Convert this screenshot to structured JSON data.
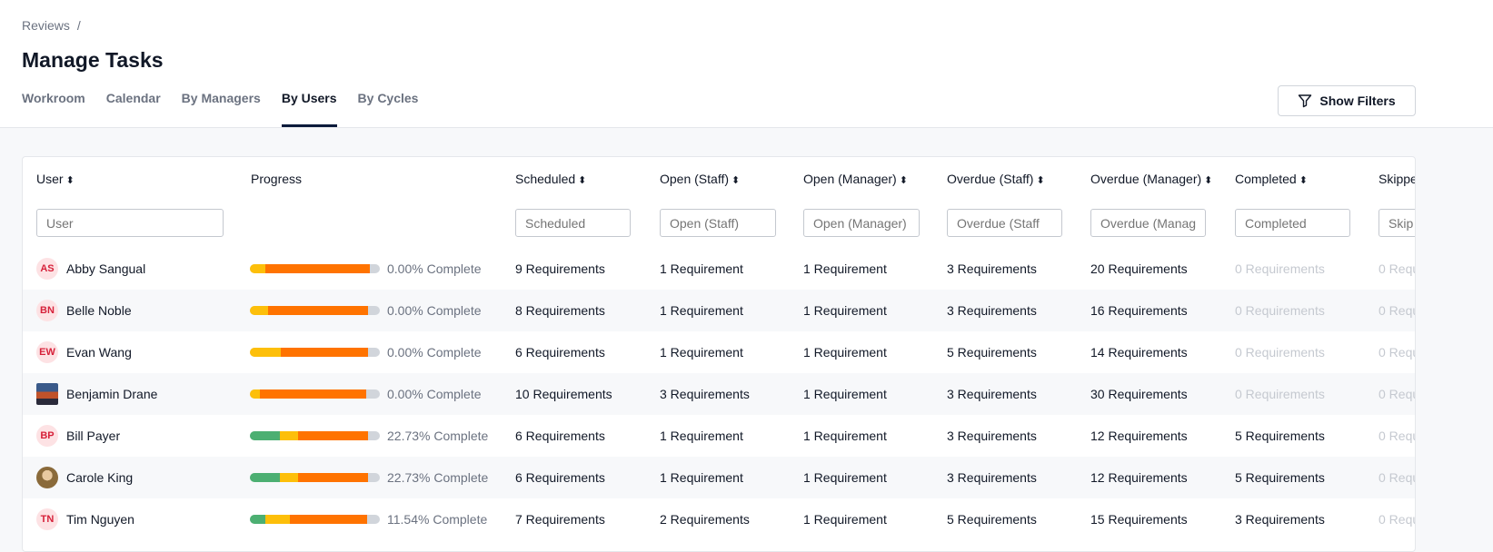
{
  "breadcrumb": {
    "parent": "Reviews",
    "separator": "/"
  },
  "page_title": "Manage Tasks",
  "tabs": [
    {
      "label": "Workroom"
    },
    {
      "label": "Calendar"
    },
    {
      "label": "By Managers"
    },
    {
      "label": "By Users",
      "active": true
    },
    {
      "label": "By Cycles"
    }
  ],
  "show_filters": {
    "label": "Show Filters",
    "icon": "filter-icon"
  },
  "colors": {
    "completed": "#4caf72",
    "open": "#fdbf0a",
    "overdue": "#ff7300",
    "remaining": "#d1d5db",
    "accent": "#0b1a3a"
  },
  "columns": [
    {
      "label": "User",
      "sortable": true,
      "placeholder": "User"
    },
    {
      "label": "Progress",
      "sortable": false
    },
    {
      "label": "Scheduled",
      "sortable": true,
      "placeholder": "Scheduled"
    },
    {
      "label": "Open (Staff)",
      "sortable": true,
      "placeholder": "Open (Staff)"
    },
    {
      "label": "Open (Manager)",
      "sortable": true,
      "placeholder": "Open (Manager)"
    },
    {
      "label": "Overdue (Staff)",
      "sortable": true,
      "placeholder": "Overdue (Staff"
    },
    {
      "label": "Overdue (Manager)",
      "sortable": true,
      "placeholder": "Overdue (Manag"
    },
    {
      "label": "Completed",
      "sortable": true,
      "placeholder": "Completed"
    },
    {
      "label": "Skippe",
      "sortable": true,
      "placeholder": "Skip"
    }
  ],
  "rows": [
    {
      "initials": "AS",
      "name": "Abby Sangual",
      "progress": {
        "completed": 0,
        "open": 12,
        "overdue": 80
      },
      "pct": "0.00% Complete",
      "scheduled": "9 Requirements",
      "open_staff": "1 Requirement",
      "open_manager": "1 Requirement",
      "overdue_staff": "3 Requirements",
      "overdue_manager": "20 Requirements",
      "completed": "0 Requirements",
      "skipped": "0 Requ"
    },
    {
      "initials": "BN",
      "name": "Belle Noble",
      "progress": {
        "completed": 0,
        "open": 14,
        "overdue": 77
      },
      "pct": "0.00% Complete",
      "scheduled": "8 Requirements",
      "open_staff": "1 Requirement",
      "open_manager": "1 Requirement",
      "overdue_staff": "3 Requirements",
      "overdue_manager": "16 Requirements",
      "completed": "0 Requirements",
      "skipped": "0 Requ"
    },
    {
      "initials": "EW",
      "name": "Evan Wang",
      "progress": {
        "completed": 0,
        "open": 24,
        "overdue": 67
      },
      "pct": "0.00% Complete",
      "scheduled": "6 Requirements",
      "open_staff": "1 Requirement",
      "open_manager": "1 Requirement",
      "overdue_staff": "5 Requirements",
      "overdue_manager": "14 Requirements",
      "completed": "0 Requirements",
      "skipped": "0 Requ"
    },
    {
      "photo": "landscape",
      "name": "Benjamin Drane",
      "progress": {
        "completed": 0,
        "open": 8,
        "overdue": 81.5
      },
      "pct": "0.00% Complete",
      "scheduled": "10 Requirements",
      "open_staff": "3 Requirements",
      "open_manager": "1 Requirement",
      "overdue_staff": "3 Requirements",
      "overdue_manager": "30 Requirements",
      "completed": "0 Requirements",
      "skipped": "0 Requ"
    },
    {
      "initials": "BP",
      "name": "Bill Payer",
      "progress": {
        "completed": 22.73,
        "open": 14,
        "overdue": 54
      },
      "pct": "22.73% Complete",
      "scheduled": "6 Requirements",
      "open_staff": "1 Requirement",
      "open_manager": "1 Requirement",
      "overdue_staff": "3 Requirements",
      "overdue_manager": "12 Requirements",
      "completed": "5 Requirements",
      "skipped": "0 Requ"
    },
    {
      "photo": "portrait",
      "name": "Carole King",
      "progress": {
        "completed": 22.73,
        "open": 14,
        "overdue": 54
      },
      "pct": "22.73% Complete",
      "scheduled": "6 Requirements",
      "open_staff": "1 Requirement",
      "open_manager": "1 Requirement",
      "overdue_staff": "3 Requirements",
      "overdue_manager": "12 Requirements",
      "completed": "5 Requirements",
      "skipped": "0 Requ"
    },
    {
      "initials": "TN",
      "name": "Tim Nguyen",
      "progress": {
        "completed": 11.54,
        "open": 19,
        "overdue": 60
      },
      "pct": "11.54% Complete",
      "scheduled": "7 Requirements",
      "open_staff": "2 Requirements",
      "open_manager": "1 Requirement",
      "overdue_staff": "5 Requirements",
      "overdue_manager": "15 Requirements",
      "completed": "3 Requirements",
      "skipped": "0 Requ"
    }
  ]
}
